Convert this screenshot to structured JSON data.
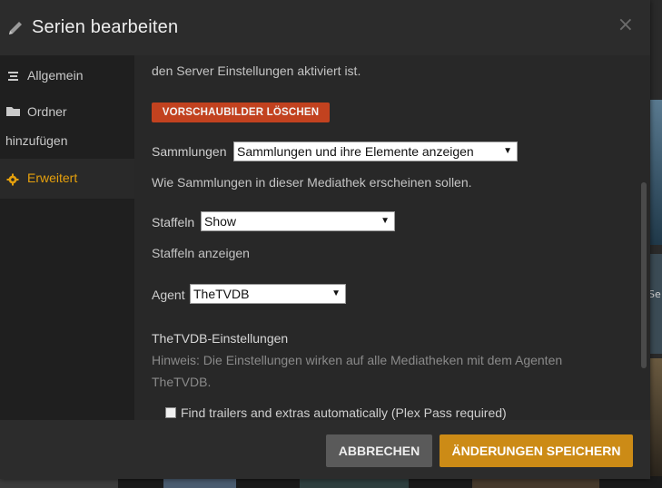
{
  "dialog": {
    "title": "Serien bearbeiten",
    "close_label": "×"
  },
  "sidebar": {
    "items": [
      {
        "label": "Allgemein",
        "icon": "list-icon",
        "active": false
      },
      {
        "label": "Ordner hinzufügen",
        "label_line1": "Ordner",
        "label_line2": "hinzufügen",
        "icon": "folder-icon",
        "active": false
      },
      {
        "label": "Erweitert",
        "icon": "gear-icon",
        "active": true
      }
    ]
  },
  "content": {
    "top_text": "den Server Einstellungen aktiviert ist.",
    "delete_thumbnails_button": "VORSCHAUBILDER LÖSCHEN",
    "collections": {
      "label": "Sammlungen",
      "value": "Sammlungen und ihre Elemente anzeigen",
      "helper": "Wie Sammlungen in dieser Mediathek erscheinen sollen."
    },
    "seasons": {
      "label": "Staffeln",
      "value": "Show",
      "helper": "Staffeln anzeigen"
    },
    "agent": {
      "label": "Agent",
      "value": "TheTVDB"
    },
    "agent_settings": {
      "title": "TheTVDB-Einstellungen",
      "hint_line1": "Hinweis: Die Einstellungen wirken auf alle Mediatheken mit dem Agenten",
      "hint_line2": "TheTVDB."
    },
    "trailers_checkbox": {
      "label": "Find trailers and extras automatically (Plex Pass required)",
      "checked": false
    }
  },
  "footer": {
    "cancel_label": "ABBRECHEN",
    "save_label": "ÄNDERUNGEN SPEICHERN"
  },
  "background": {
    "partial_text": "Se"
  },
  "colors": {
    "accent": "#e5a00d",
    "danger_button": "#c2421f",
    "save_button": "#cc8b16",
    "cancel_button": "#5a5a5a"
  }
}
